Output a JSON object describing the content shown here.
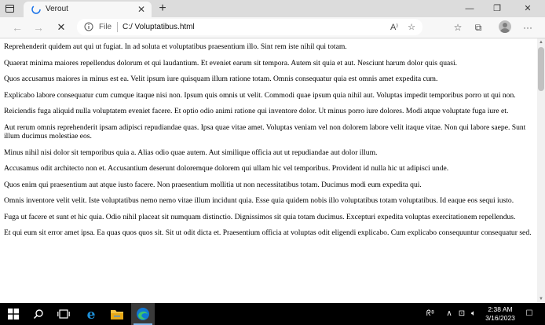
{
  "browser": {
    "tab": {
      "title": "Verout",
      "close_glyph": "✕"
    },
    "new_tab_glyph": "+",
    "window_controls": {
      "minimize": "—",
      "restore": "❐",
      "close": "✕"
    },
    "nav": {
      "back": "←",
      "forward": "→",
      "stop": "✕"
    },
    "address": {
      "scheme": "File",
      "url": "C:/ Voluptatibus.html"
    },
    "address_icons": {
      "read_aloud": "A⁾",
      "favorite": "☆"
    },
    "toolbar_icons": {
      "favorites": "☆",
      "collections": "⧉",
      "split": "▢",
      "more": "···"
    }
  },
  "paragraphs": [
    "Reprehenderit quidem aut qui ut fugiat. In ad soluta et voluptatibus praesentium illo. Sint rem iste nihil qui totam.",
    "Quaerat minima maiores repellendus dolorum et qui laudantium. Et eveniet earum sit tempora. Autem sit quia et aut. Nesciunt harum dolor quis quasi.",
    "Quos accusamus maiores in minus est ea. Velit ipsum iure quisquam illum ratione totam. Omnis consequatur quia est omnis amet expedita cum.",
    "Explicabo labore consequatur cum cumque itaque nisi non. Ipsum quis omnis ut velit. Commodi quae ipsum quia nihil aut. Voluptas impedit temporibus porro ut qui non.",
    "Reiciendis fuga aliquid nulla voluptatem eveniet facere. Et optio odio animi ratione qui inventore dolor. Ut minus porro iure dolores. Modi atque voluptate fuga iure et.",
    "Aut rerum omnis reprehenderit ipsam adipisci repudiandae quas. Ipsa quae vitae amet. Voluptas veniam vel non dolorem labore velit itaque vitae. Non qui labore saepe. Sunt illum ducimus molestiae eos.",
    "Minus nihil nisi dolor sit temporibus quia a. Alias odio quae autem. Aut similique officia aut ut repudiandae aut dolor illum.",
    "Accusamus odit architecto non et. Accusantium deserunt doloremque dolorem qui ullam hic vel temporibus. Provident id nulla hic ut adipisci unde.",
    "Quos enim qui praesentium aut atque iusto facere. Non praesentium mollitia ut non necessitatibus totam. Ducimus modi eum expedita qui.",
    "Omnis inventore velit velit. Iste voluptatibus nemo nemo vitae illum incidunt quia. Esse quia quidem nobis illo voluptatibus totam voluptatibus. Id eaque eos sequi iusto.",
    "Fuga ut facere et sunt et hic quia. Odio nihil placeat sit numquam distinctio. Dignissimos sit quia totam ducimus. Excepturi expedita voluptas exercitationem repellendus.",
    "Et qui eum sit error amet ipsa. Ea quas quos quos sit. Sit ut odit dicta et. Praesentium officia at voluptas odit eligendi explicabo. Cum explicabo consequuntur consequatur sed."
  ],
  "scrollbar": {
    "up": "▲",
    "down": "▼"
  },
  "taskbar": {
    "search_glyph": "⚲",
    "tray": {
      "people": "ᖇ⁸",
      "chevron": "∧",
      "network": "⊡",
      "volume": "🔈︎",
      "notifications": "☐"
    },
    "clock": {
      "time": "2:38 AM",
      "date": "3/16/2023"
    }
  },
  "colors": {
    "edge_blue": "#0f78d4",
    "edge_green": "#3ec46d",
    "ie_blue": "#1e90d8",
    "explorer_yellow": "#f5c242"
  }
}
